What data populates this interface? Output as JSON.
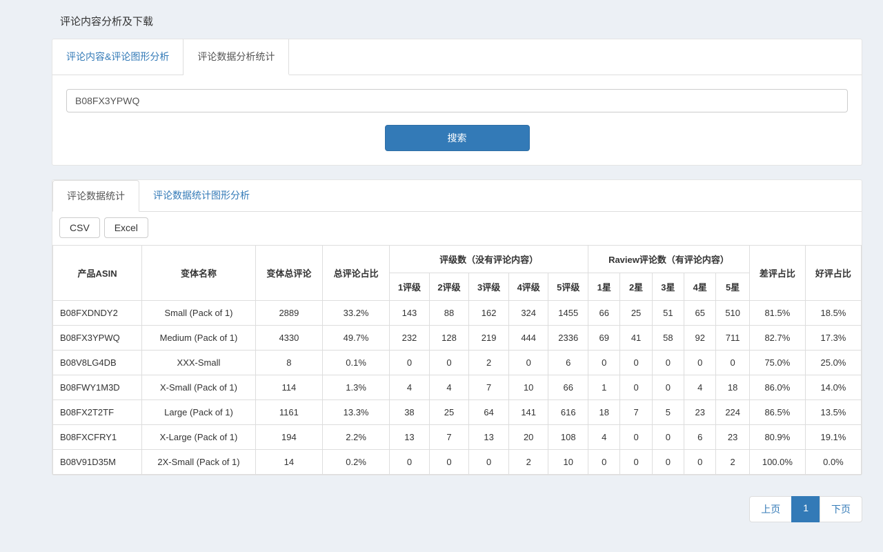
{
  "page": {
    "title": "评论内容分析及下载"
  },
  "topTabs": [
    {
      "label": "评论内容&评论图形分析",
      "active": false
    },
    {
      "label": "评论数据分析统计",
      "active": true
    }
  ],
  "search": {
    "value": "B08FX3YPWQ",
    "button": "搜索"
  },
  "innerTabs": [
    {
      "label": "评论数据统计",
      "active": true
    },
    {
      "label": "评论数据统计图形分析",
      "active": false
    }
  ],
  "export": {
    "csv": "CSV",
    "excel": "Excel"
  },
  "table": {
    "headers": {
      "asin": "产品ASIN",
      "variant": "变体名称",
      "totalReviews": "变体总评论",
      "totalRatio": "总评论占比",
      "ratingGroup": "评级数（没有评论内容）",
      "r1": "1评级",
      "r2": "2评级",
      "r3": "3评级",
      "r4": "4评级",
      "r5": "5评级",
      "reviewGroup": "Raview评论数（有评论内容）",
      "s1": "1星",
      "s2": "2星",
      "s3": "3星",
      "s4": "4星",
      "s5": "5星",
      "badRatio": "差评占比",
      "goodRatio": "好评占比"
    },
    "rows": [
      {
        "asin": "B08FXDNDY2",
        "variant": "Small (Pack of 1)",
        "total": "2889",
        "ratio": "33.2%",
        "r1": "143",
        "r2": "88",
        "r3": "162",
        "r4": "324",
        "r5": "1455",
        "s1": "66",
        "s2": "25",
        "s3": "51",
        "s4": "65",
        "s5": "510",
        "bad": "81.5%",
        "good": "18.5%"
      },
      {
        "asin": "B08FX3YPWQ",
        "variant": "Medium (Pack of 1)",
        "total": "4330",
        "ratio": "49.7%",
        "r1": "232",
        "r2": "128",
        "r3": "219",
        "r4": "444",
        "r5": "2336",
        "s1": "69",
        "s2": "41",
        "s3": "58",
        "s4": "92",
        "s5": "711",
        "bad": "82.7%",
        "good": "17.3%"
      },
      {
        "asin": "B08V8LG4DB",
        "variant": "XXX-Small",
        "total": "8",
        "ratio": "0.1%",
        "r1": "0",
        "r2": "0",
        "r3": "2",
        "r4": "0",
        "r5": "6",
        "s1": "0",
        "s2": "0",
        "s3": "0",
        "s4": "0",
        "s5": "0",
        "bad": "75.0%",
        "good": "25.0%"
      },
      {
        "asin": "B08FWY1M3D",
        "variant": "X-Small (Pack of 1)",
        "total": "114",
        "ratio": "1.3%",
        "r1": "4",
        "r2": "4",
        "r3": "7",
        "r4": "10",
        "r5": "66",
        "s1": "1",
        "s2": "0",
        "s3": "0",
        "s4": "4",
        "s5": "18",
        "bad": "86.0%",
        "good": "14.0%"
      },
      {
        "asin": "B08FX2T2TF",
        "variant": "Large (Pack of 1)",
        "total": "1161",
        "ratio": "13.3%",
        "r1": "38",
        "r2": "25",
        "r3": "64",
        "r4": "141",
        "r5": "616",
        "s1": "18",
        "s2": "7",
        "s3": "5",
        "s4": "23",
        "s5": "224",
        "bad": "86.5%",
        "good": "13.5%"
      },
      {
        "asin": "B08FXCFRY1",
        "variant": "X-Large (Pack of 1)",
        "total": "194",
        "ratio": "2.2%",
        "r1": "13",
        "r2": "7",
        "r3": "13",
        "r4": "20",
        "r5": "108",
        "s1": "4",
        "s2": "0",
        "s3": "0",
        "s4": "6",
        "s5": "23",
        "bad": "80.9%",
        "good": "19.1%"
      },
      {
        "asin": "B08V91D35M",
        "variant": "2X-Small (Pack of 1)",
        "total": "14",
        "ratio": "0.2%",
        "r1": "0",
        "r2": "0",
        "r3": "0",
        "r4": "2",
        "r5": "10",
        "s1": "0",
        "s2": "0",
        "s3": "0",
        "s4": "0",
        "s5": "2",
        "bad": "100.0%",
        "good": "0.0%"
      }
    ]
  },
  "pagination": {
    "prev": "上页",
    "current": "1",
    "next": "下页"
  }
}
